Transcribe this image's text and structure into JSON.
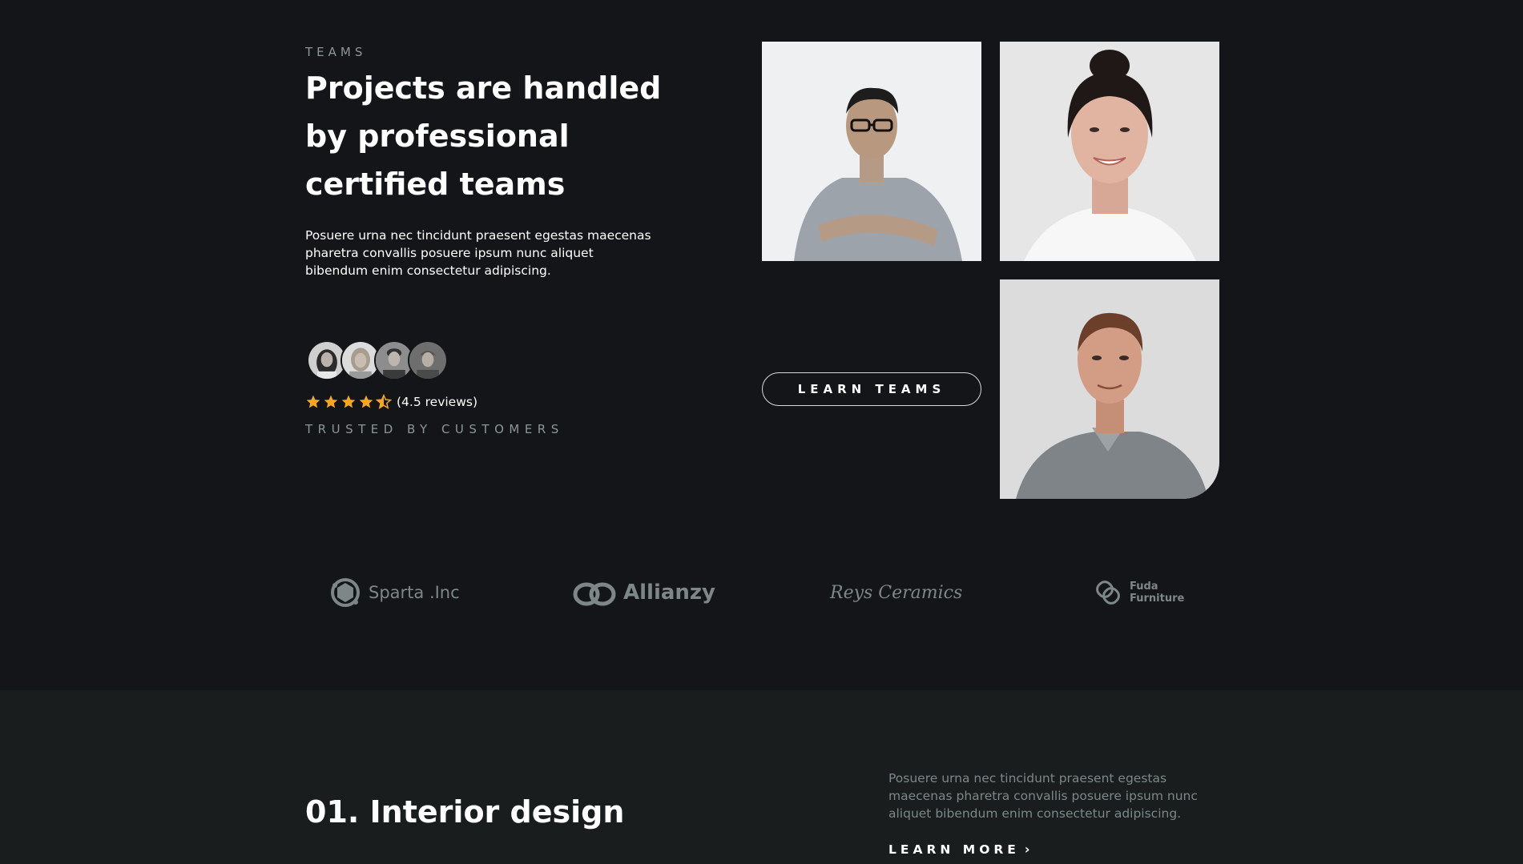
{
  "teams": {
    "eyebrow": "TEAMS",
    "headline": "Projects are handled by professional certified teams",
    "description": "Posuere urna nec tincidunt praesent egestas maecenas pharetra convallis posuere ipsum nunc aliquet bibendum enim consectetur adipiscing.",
    "rating": {
      "stars": 4.5,
      "text": "(4.5 reviews)",
      "star_color": "#f5a623"
    },
    "trusted_label": "TRUSTED BY CUSTOMERS",
    "learn_button": "LEARN TEAMS"
  },
  "logos": [
    {
      "name": "Sparta .Inc"
    },
    {
      "name": "Allianzy"
    },
    {
      "name": "Reys Ceramics"
    },
    {
      "name_line1": "Fuda",
      "name_line2": "Furniture"
    }
  ],
  "service": {
    "title": "01. Interior design",
    "description": "Posuere urna nec tincidunt praesent egestas maecenas pharetra convallis posuere ipsum nunc aliquet bibendum enim consectetur adipiscing.",
    "link": "LEARN MORE"
  },
  "colors": {
    "background": "#141518",
    "section_background": "#1a1d1e",
    "muted_text": "#8c9696",
    "accent_star": "#f5a623"
  }
}
